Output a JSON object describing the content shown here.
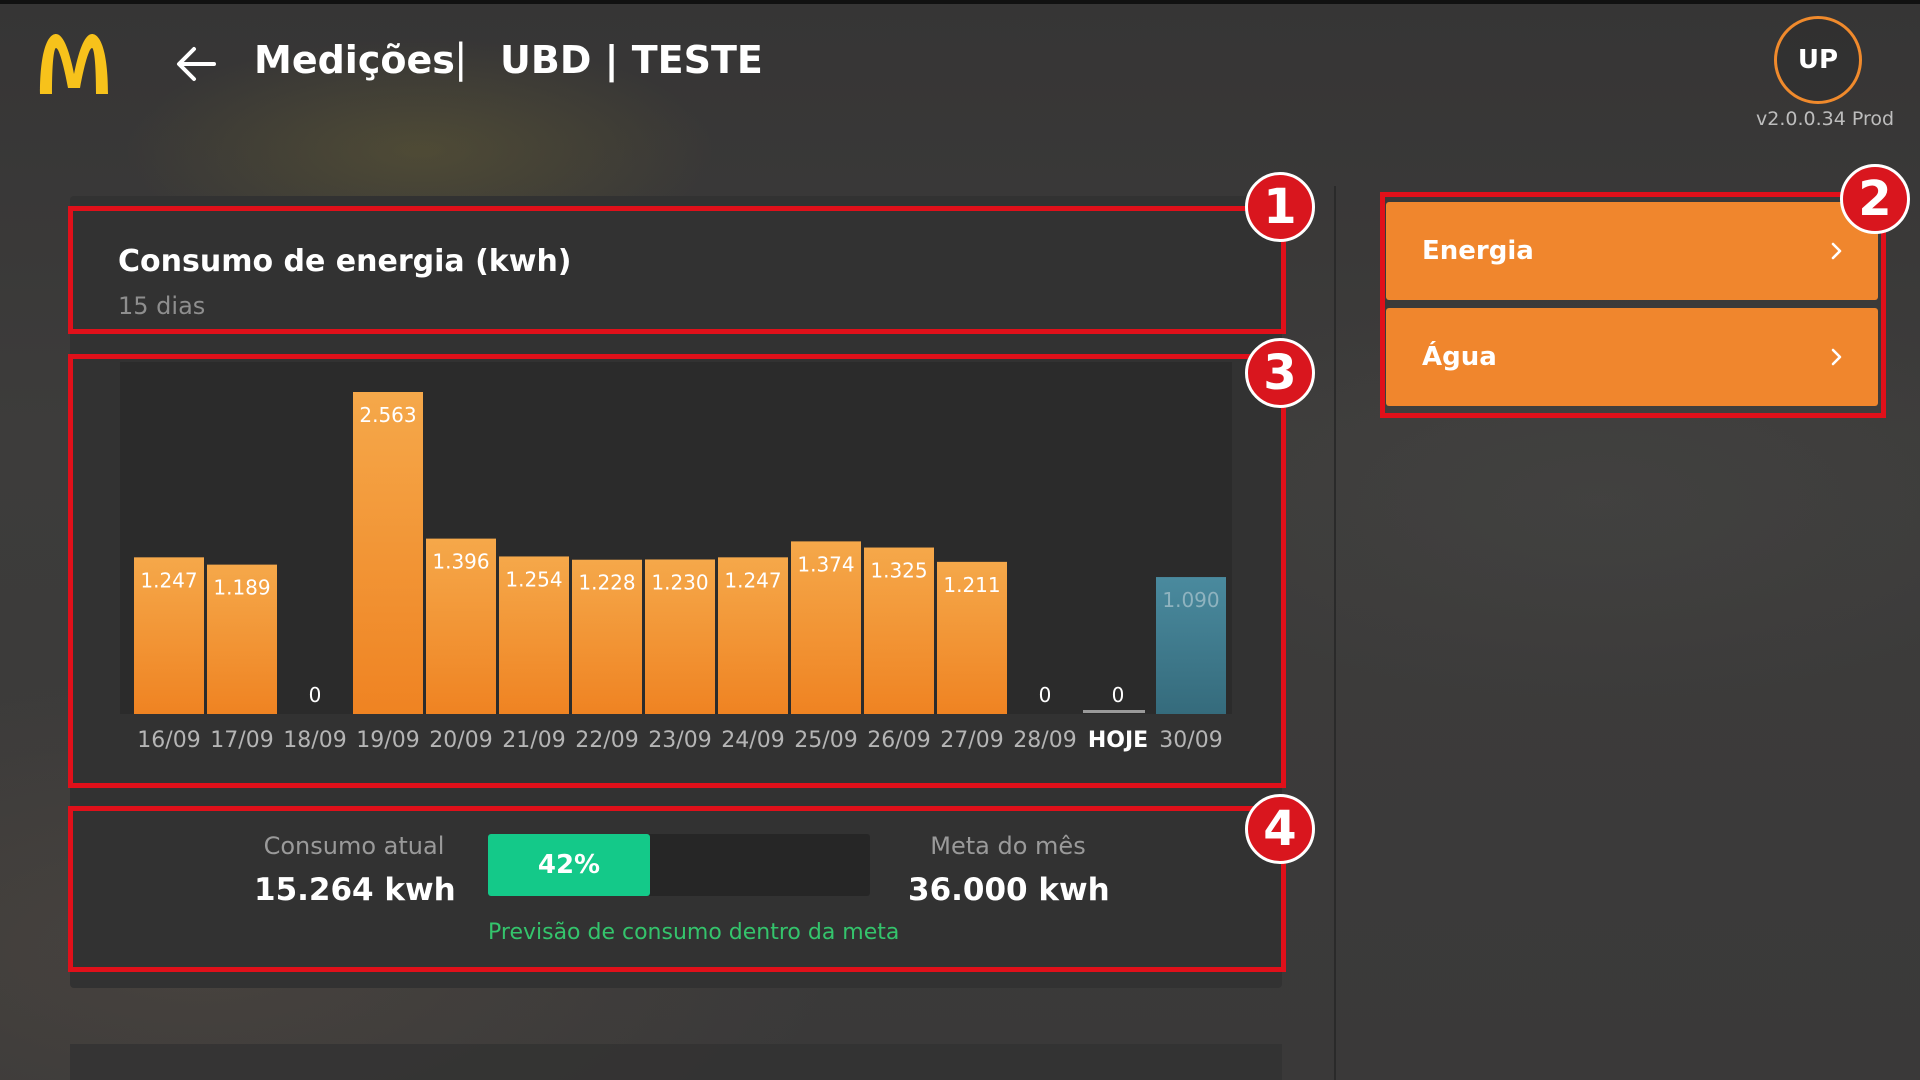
{
  "header": {
    "title": "Medições",
    "separator": "|",
    "unit": "UBD | TESTE",
    "avatar_initials": "UP",
    "version": "v2.0.0.34 Prod"
  },
  "card": {
    "title": "Consumo de energia (kwh)",
    "subtitle": "15 dias"
  },
  "chart_data": {
    "type": "bar",
    "categories": [
      "16/09",
      "17/09",
      "18/09",
      "19/09",
      "20/09",
      "21/09",
      "22/09",
      "23/09",
      "24/09",
      "25/09",
      "26/09",
      "27/09",
      "28/09",
      "HOJE",
      "30/09"
    ],
    "values": [
      1247,
      1189,
      0,
      2563,
      1396,
      1254,
      1228,
      1230,
      1247,
      1374,
      1325,
      1211,
      0,
      0,
      1090
    ],
    "value_labels": [
      "1.247",
      "1.189",
      "0",
      "2.563",
      "1.396",
      "1.254",
      "1.228",
      "1.230",
      "1.247",
      "1.374",
      "1.325",
      "1.211",
      "0",
      "0",
      "1.090"
    ],
    "highlight_category": "HOJE",
    "forecast_category": "30/09",
    "colors": {
      "bar": "#f08a2c",
      "bar_top": "#f5a84a",
      "forecast": "#3e7a8e",
      "today_line": "#9a9a9a"
    },
    "ylim": [
      0,
      2800
    ]
  },
  "summary": {
    "current_label": "Consumo atual",
    "current_value": "15.264 kwh",
    "progress_percent": 42,
    "progress_label": "42%",
    "goal_label": "Meta do mês",
    "goal_value": "36.000 kwh",
    "forecast_text": "Previsão de consumo dentro da meta"
  },
  "menu": {
    "items": [
      {
        "label": "Energia",
        "icon": "chevron-right-icon"
      },
      {
        "label": "Água",
        "icon": "chevron-right-icon"
      }
    ]
  },
  "annotations": [
    "1",
    "2",
    "3",
    "4"
  ],
  "colors": {
    "accent": "#f0862d",
    "progress": "#14c989",
    "forecast_text": "#34c46c",
    "annotation": "#e0101a"
  }
}
